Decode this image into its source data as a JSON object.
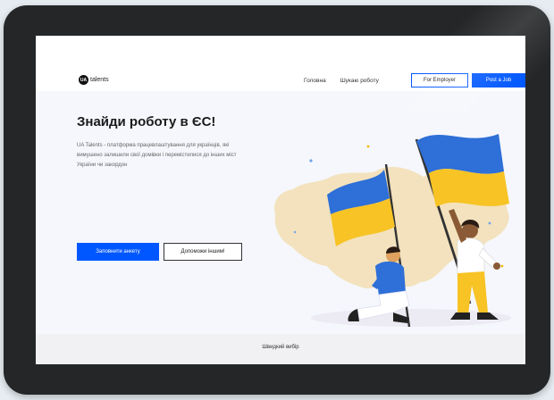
{
  "header": {
    "logo_mark": "UA",
    "logo_text": "talents",
    "nav": [
      "Головна",
      "Шукаю роботу"
    ],
    "employer_button": "For Employer",
    "post_job_button": "Post a Job"
  },
  "hero": {
    "title": "Знайди роботу в ЄС!",
    "description": "UA Talents - платформа працевлаштування для українців, які вимушено залишили свої домівки і перемістилися до інших міст України чи закордон",
    "fill_form_button": "Заповнити анкету",
    "help_button": "Допоможи іншим!"
  },
  "footer": {
    "quick_choice": "Швидкий вибір"
  },
  "colors": {
    "accent": "#0057ff",
    "flag_blue": "#2e6fd8",
    "flag_yellow": "#f7c325",
    "map": "#f3e2bd"
  }
}
